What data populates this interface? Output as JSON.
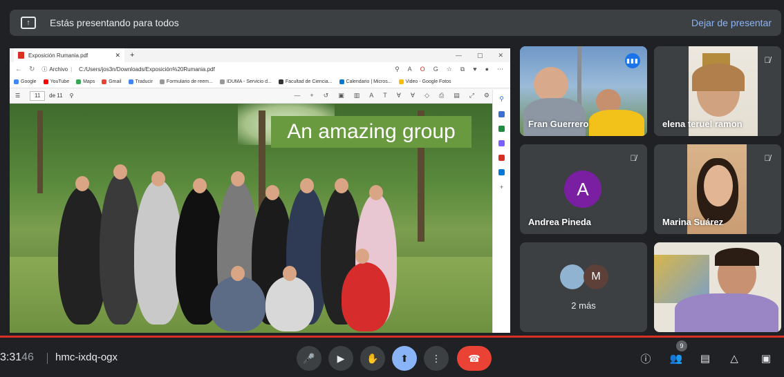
{
  "banner": {
    "text": "Estás presentando para todos",
    "stop_label": "Dejar de presentar"
  },
  "browser": {
    "tab_title": "Exposición Rumania.pdf",
    "address_prefix": "Archivo",
    "url": "C:/Users/jos3n/Downloads/Exposición%20Rumania.pdf",
    "bookmarks": [
      "Google",
      "YouTube",
      "Maps",
      "Gmail",
      "Traducir",
      "Formulario de reem...",
      "IDUMA - Servicio d...",
      "Facultad de Ciencia...",
      "Calendario | Micros...",
      "Video - Google Fotos"
    ],
    "page_current": "11",
    "page_total": "de 11"
  },
  "slide": {
    "caption": "An amazing group"
  },
  "participants": [
    {
      "name": "Fran Guerrero",
      "muted": false,
      "speaking": true
    },
    {
      "name": "elena teruel ramon",
      "muted": true
    },
    {
      "name": "Andrea Pineda",
      "muted": true,
      "initial": "A"
    },
    {
      "name": "Marina Suárez",
      "muted": true
    },
    {
      "more_label": "2 más",
      "initial": "M"
    },
    {
      "name": "",
      "muted": false
    }
  ],
  "bottom": {
    "time": "3:31",
    "time_suffix": "46",
    "meeting_code": "hmc-ixdq-ogx",
    "participant_count": "9"
  },
  "colors": {
    "background": "#202124",
    "accent": "#8ab4f8",
    "hangup": "#ea4335",
    "avatar_a": "#7b1fa2"
  }
}
